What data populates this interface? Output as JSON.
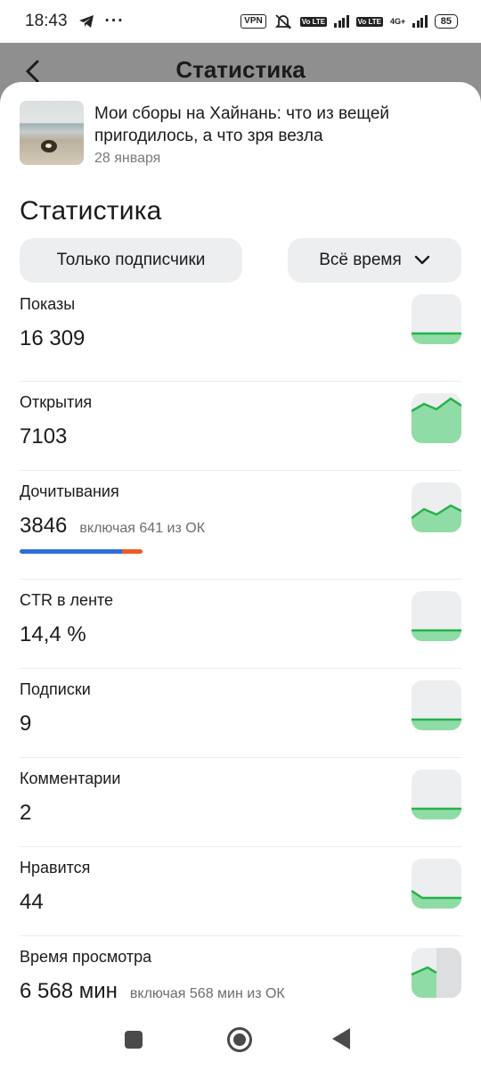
{
  "status_bar": {
    "time": "18:43",
    "more": "···",
    "vpn": "VPN",
    "volte": "Vo LTE",
    "net": "4G+",
    "battery": "85"
  },
  "background_page": {
    "title": "Статистика"
  },
  "article": {
    "title": "Мои сборы на Хайнань: что из вещей пригодилось, а что зря везла",
    "date": "28 января"
  },
  "section_title": "Статистика",
  "filters": {
    "audience": "Только подписчики",
    "period": "Всё время"
  },
  "colors": {
    "accent_green": "#27b14a",
    "fill_green": "#8fdca6",
    "progress_blue": "#2d6fd8",
    "progress_orange": "#ee5b23"
  },
  "metrics": [
    {
      "label": "Показы",
      "value": "16 309",
      "trend": "flat"
    },
    {
      "label": "Открытия",
      "value": "7103",
      "trend": "rising"
    },
    {
      "label": "Дочитывания",
      "value": "3846",
      "note": "включая 641 из ОК",
      "trend": "rising",
      "ok_fraction": 0.167
    },
    {
      "label": "CTR в ленте",
      "value": "14,4 %",
      "trend": "flat"
    },
    {
      "label": "Подписки",
      "value": "9",
      "trend": "flat"
    },
    {
      "label": "Комментарии",
      "value": "2",
      "trend": "flat"
    },
    {
      "label": "Нравится",
      "value": "44",
      "trend": "falling"
    },
    {
      "label": "Время просмотра",
      "value": "6 568 мин",
      "note": "включая 568 мин из ОК",
      "trend": "partial"
    }
  ]
}
